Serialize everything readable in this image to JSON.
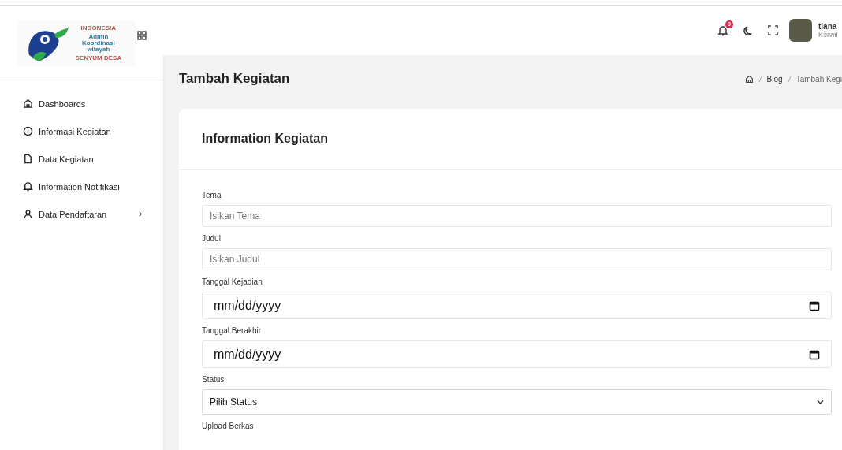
{
  "logo": {
    "top": "INDONESIA",
    "title": "Admin Koordinasi wilayah",
    "bottom": "SENYUM DESA"
  },
  "sidebar": {
    "items": [
      {
        "label": "Dashboards",
        "expandable": false
      },
      {
        "label": "Informasi Kegiatan",
        "expandable": false
      },
      {
        "label": "Data Kegiatan",
        "expandable": false
      },
      {
        "label": "Information Notifikasi",
        "expandable": false
      },
      {
        "label": "Data Pendaftaran",
        "expandable": true
      }
    ]
  },
  "header": {
    "notification_count": "3",
    "user": {
      "name": "tiana",
      "role": "Korwil"
    }
  },
  "page_title": "Tambah Kegiatan",
  "breadcrumb": [
    "Blog",
    "Tambah Kegi"
  ],
  "card": {
    "title": "Information Kegiatan",
    "fields": [
      {
        "label": "Tema",
        "kind": "text",
        "placeholder": "Isikan Tema"
      },
      {
        "label": "Judul",
        "kind": "text",
        "placeholder": "Isikan Judul"
      },
      {
        "label": "Tanggal Kejadian",
        "kind": "date",
        "placeholder": "mm/dd/yyyy"
      },
      {
        "label": "Tanggal Berakhir",
        "kind": "date",
        "placeholder": "mm/dd/yyyy"
      },
      {
        "label": "Status",
        "kind": "select",
        "value": "Pilih Status"
      }
    ],
    "next_label": "Upload Berkas"
  }
}
